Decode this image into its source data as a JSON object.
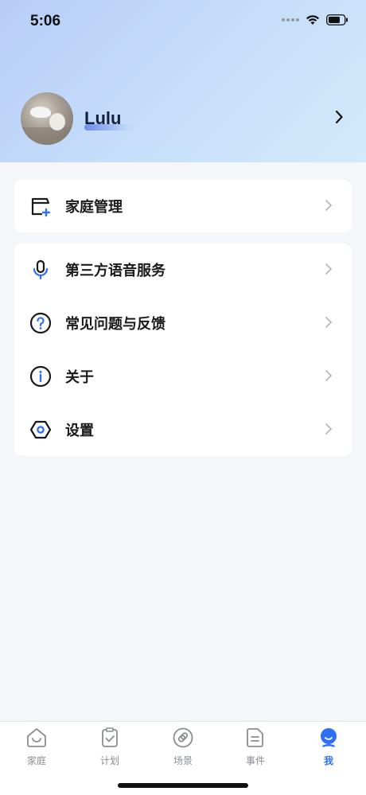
{
  "status_bar": {
    "time": "5:06"
  },
  "profile": {
    "username": "Lulu"
  },
  "menu_group_1": [
    {
      "label": "家庭管理",
      "icon": "home-management-icon"
    }
  ],
  "menu_group_2": [
    {
      "label": "第三方语音服务",
      "icon": "microphone-icon"
    },
    {
      "label": "常见问题与反馈",
      "icon": "question-icon"
    },
    {
      "label": "关于",
      "icon": "info-icon"
    },
    {
      "label": "设置",
      "icon": "settings-icon"
    }
  ],
  "tabbar": [
    {
      "label": "家庭",
      "icon": "home-tab-icon",
      "active": false
    },
    {
      "label": "计划",
      "icon": "plan-tab-icon",
      "active": false
    },
    {
      "label": "场景",
      "icon": "scene-tab-icon",
      "active": false
    },
    {
      "label": "事件",
      "icon": "event-tab-icon",
      "active": false
    },
    {
      "label": "我",
      "icon": "me-tab-icon",
      "active": true
    }
  ],
  "colors": {
    "accent": "#2f6ff6",
    "text": "#1a1a1a",
    "background": "#f5f6fa"
  }
}
